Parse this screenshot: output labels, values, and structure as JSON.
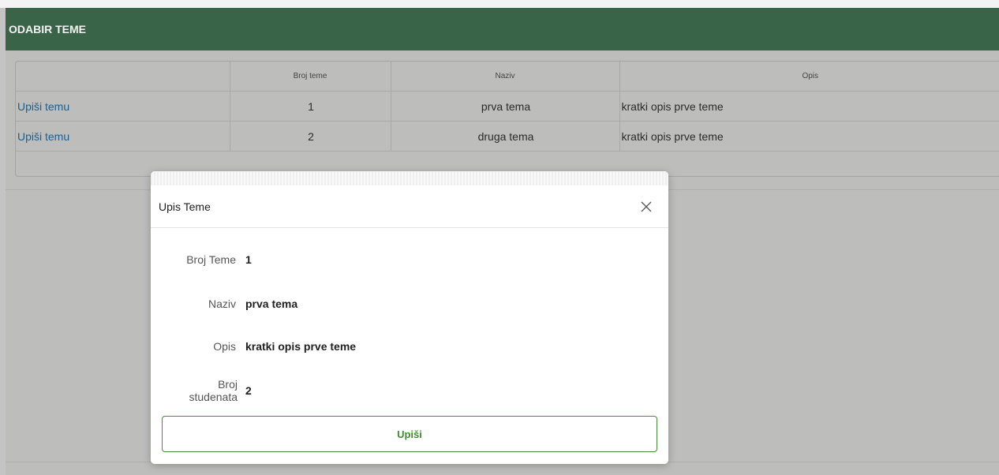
{
  "region": {
    "title": "ODABIR TEME",
    "header_color": "#3a6448"
  },
  "report": {
    "columns": [
      "",
      "Broj teme",
      "Naziv",
      "Opis"
    ],
    "rows": [
      {
        "action": "Upiši temu",
        "broj": "1",
        "naziv": "prva tema",
        "opis": "kratki opis prve teme"
      },
      {
        "action": "Upiši temu",
        "broj": "2",
        "naziv": "druga tema",
        "opis": "kratki opis prve teme"
      }
    ]
  },
  "dialog": {
    "title": "Upis Teme",
    "close_icon": "close-icon",
    "fields": [
      {
        "label": "Broj Teme",
        "value": "1"
      },
      {
        "label": "Naziv",
        "value": "prva tema"
      },
      {
        "label": "Opis",
        "value": "kratki opis prve teme"
      },
      {
        "label": "Broj studenata",
        "value": "2"
      }
    ],
    "submit_label": "Upiši",
    "submit_color": "#3f8b2f"
  }
}
